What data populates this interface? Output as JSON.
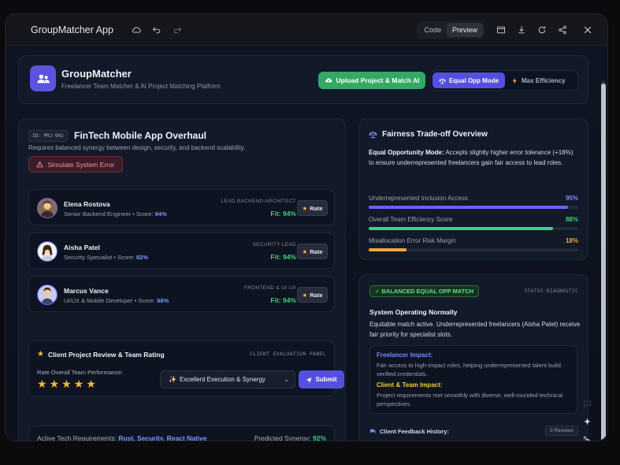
{
  "window": {
    "title": "GroupMatcher App",
    "tabs": [
      {
        "label": "Code"
      },
      {
        "label": "Preview"
      }
    ]
  },
  "header": {
    "brand": "GroupMatcher",
    "subtitle": "Freelancer Team Matcher & AI Project Matching Platform",
    "upload_label": "Upload Project & Match AI",
    "mode_equal": "Equal Opp Mode",
    "mode_efficiency": "Max Efficiency"
  },
  "project": {
    "id": "ID: PRJ-902",
    "title": "FinTech Mobile App Overhaul",
    "description": "Requires balanced synergy between design, security, and backend scalability.",
    "error_button": "Simulate System Error"
  },
  "members": [
    {
      "name": "Elena Rostova",
      "role": "Senior Backend Engineer",
      "score_label": "Score:",
      "score": "94%",
      "position": "LEAD BACKEND ARCHITECT",
      "fit": "Fit: 94%",
      "rate": "Rate"
    },
    {
      "name": "Aisha Patel",
      "role": "Security Specialist",
      "score_label": "Score:",
      "score": "82%",
      "position": "SECURITY LEAD",
      "fit": "Fit: 94%",
      "rate": "Rate"
    },
    {
      "name": "Marcus Vance",
      "role": "UI/UX & Mobile Developer",
      "score_label": "Score:",
      "score": "88%",
      "position": "FRONTEND & UI UX",
      "fit": "Fit: 94%",
      "rate": "Rate"
    }
  ],
  "review": {
    "title": "Client Project Review & Team Rating",
    "panel": "CLIENT EVALUATION PANEL",
    "label": "Rate Overall Team Performance:",
    "rating": 5,
    "selected": "Excellent Execution & Synergy",
    "submit": "Submit"
  },
  "requirements": {
    "label": "Active Tech Requirements:",
    "value": "Rust, Security, React Native",
    "synergy_label": "Predicted Synergy:",
    "synergy_value": "92%"
  },
  "fairness": {
    "title": "Fairness Trade-off Overview",
    "desc_bold": "Equal Opportunity Mode:",
    "desc": "Accepts slightly higher error tolerance (+18%) to ensure underrepresented freelancers gain fair access to lead roles.",
    "metrics": [
      {
        "label": "Underrepresented Inclusion Access",
        "value": "95%",
        "fraction": 0.95,
        "color": "#6a63f0"
      },
      {
        "label": "Overall Team Efficiency Score",
        "value": "88%",
        "fraction": 0.88,
        "color": "#3fd07c"
      },
      {
        "label": "Misallocation Error Risk Margin",
        "value": "18%",
        "fraction": 0.18,
        "color": "#f2a83b"
      }
    ]
  },
  "status": {
    "badge": "✓ BALANCED EQUAL OPP MATCH",
    "diag": "STATUS DIAGNOSTIC",
    "title": "System Operating Normally",
    "desc": "Equitable match active. Underrepresented freelancers (Aisha Patel) receive fair priority for specialist slots.",
    "freelancer_h": "Freelancer Impact:",
    "freelancer_p": "Fair access to high-impact roles, helping underrepresented talent build verified credentials.",
    "client_h": "Client & Team Impact:",
    "client_p": "Project requirements met smoothly with diverse, well-rounded technical perspectives.",
    "feedback": "Client Feedback History:",
    "reviews": "0 Reviews"
  }
}
